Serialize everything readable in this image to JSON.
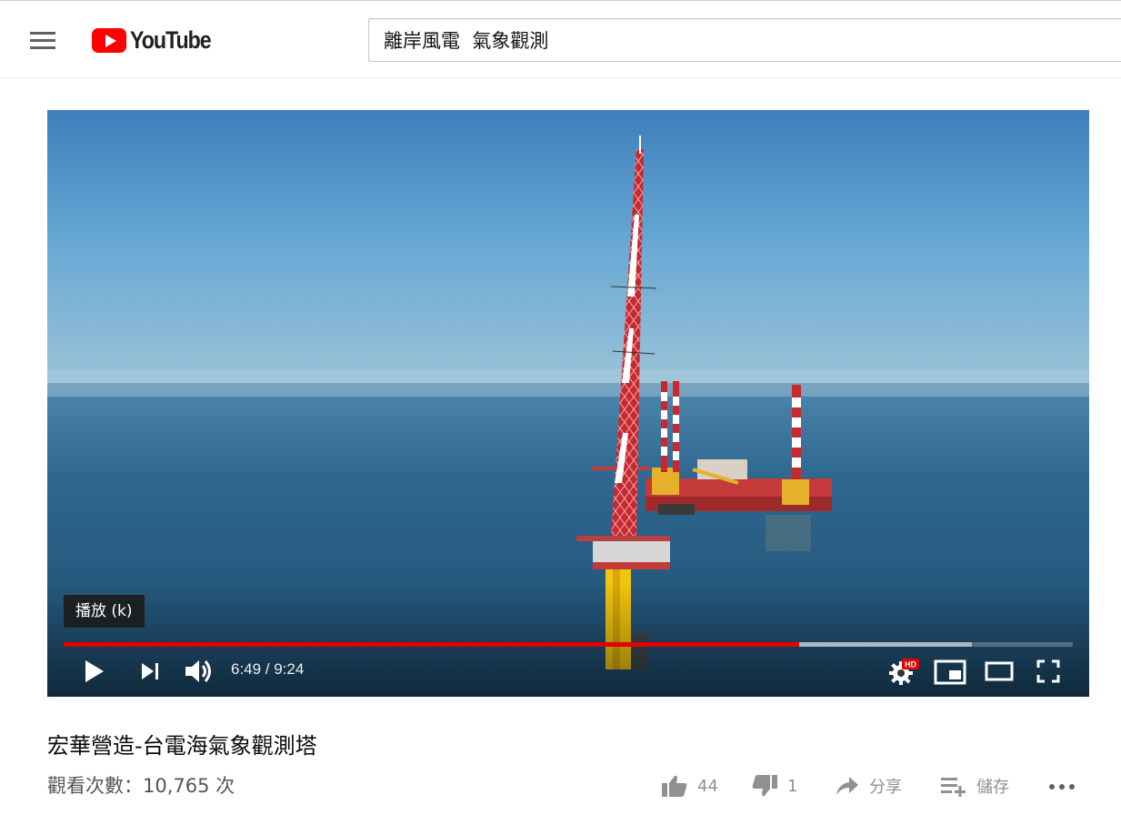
{
  "header": {
    "logo_text": "YouTube",
    "search_value": "離岸風電  氣象觀測"
  },
  "player": {
    "tooltip": "播放 (k)",
    "time": "6:49 / 9:24",
    "progress_played": 0.729,
    "progress_loaded": 0.9,
    "accent_color": "#e00000",
    "quality_badge": "HD"
  },
  "video": {
    "title": "宏華營造-台電海氣象觀測塔",
    "views": "觀看次數：10,765 次"
  },
  "actions": {
    "like_count": "44",
    "dislike_count": "1",
    "share_label": "分享",
    "save_label": "儲存"
  },
  "icons": [
    "menu-icon",
    "youtube-logo-icon",
    "play-icon",
    "next-icon",
    "volume-icon",
    "settings-icon",
    "miniplayer-icon",
    "theater-icon",
    "fullscreen-icon",
    "thumbs-up-icon",
    "thumbs-down-icon",
    "share-icon",
    "save-playlist-icon",
    "more-icon"
  ]
}
